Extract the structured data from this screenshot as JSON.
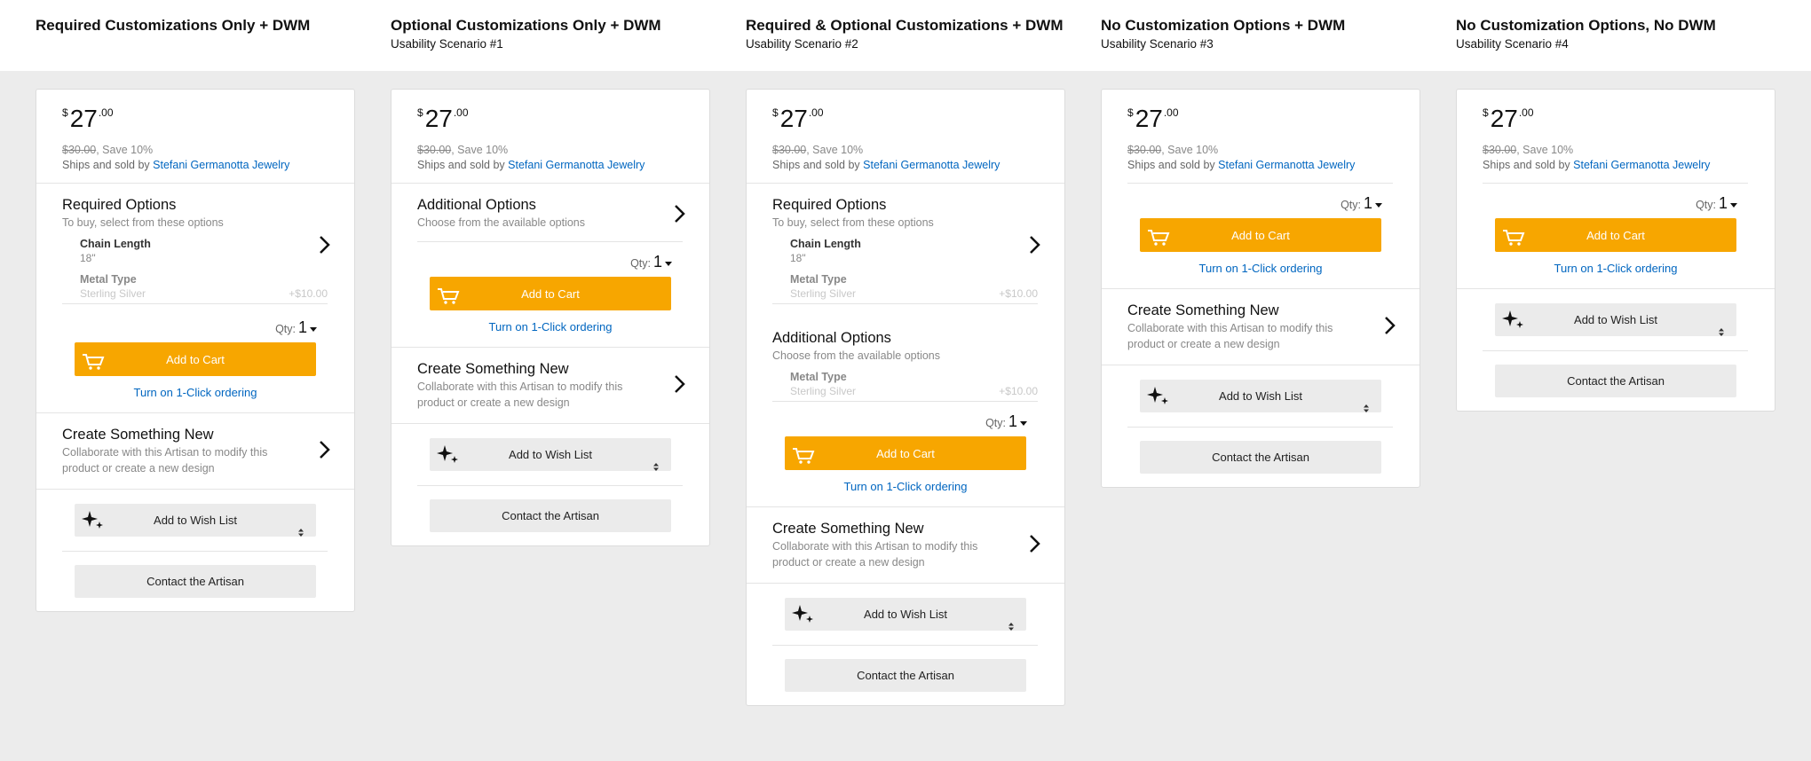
{
  "columns": [
    {
      "title": "Required Customizations Only + DWM",
      "subtitle": ""
    },
    {
      "title": "Optional Customizations Only + DWM",
      "subtitle": "Usability Scenario #1"
    },
    {
      "title": "Required & Optional Customizations + DWM",
      "subtitle": "Usability Scenario #2"
    },
    {
      "title": "No Customization Options + DWM",
      "subtitle": "Usability Scenario #3"
    },
    {
      "title": "No Customization Options, No DWM",
      "subtitle": "Usability Scenario #4"
    }
  ],
  "product": {
    "currency": "$",
    "price_whole": "27",
    "price_fraction": ".00",
    "list_price": "$30.00",
    "savings": ", Save 10%",
    "ships_prefix": "Ships and sold by ",
    "seller": "Stefani Germanotta Jewelry"
  },
  "required_options": {
    "title": "Required Options",
    "subtitle": "To buy, select from these options",
    "chain_label": "Chain Length",
    "chain_value": "18\"",
    "metal_label": "Metal Type",
    "metal_value": "Sterling Silver",
    "metal_price": "+$10.00"
  },
  "additional_options": {
    "title": "Additional Options",
    "subtitle": "Choose from the available options",
    "metal_label": "Metal Type",
    "metal_value": "Sterling Silver",
    "metal_price": "+$10.00"
  },
  "buy_box": {
    "qty_label": "Qty:",
    "qty_value": "1",
    "add_to_cart": "Add to Cart",
    "one_click": "Turn on 1-Click ordering"
  },
  "create_new": {
    "title": "Create Something New",
    "description_line1": "Collaborate with this Artisan to modify this",
    "description_line2": "product or create a new design"
  },
  "wish_list_label": "Add to Wish List",
  "contact_label": "Contact the Artisan",
  "colors": {
    "accent_orange": "#f7a600",
    "link_blue": "#0066c0",
    "background_gray": "#ececec"
  }
}
